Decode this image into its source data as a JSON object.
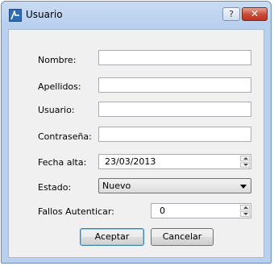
{
  "window": {
    "title": "Usuario",
    "help_label": "?",
    "close_label": "✕"
  },
  "form": {
    "nombre": {
      "label": "Nombre:",
      "value": ""
    },
    "apellidos": {
      "label": "Apellidos:",
      "value": ""
    },
    "usuario": {
      "label": "Usuario:",
      "value": ""
    },
    "contrasena": {
      "label": "Contraseña:",
      "value": ""
    },
    "fecha_alta": {
      "label": "Fecha alta:",
      "value": "23/03/2013"
    },
    "estado": {
      "label": "Estado:",
      "selected": "Nuevo"
    },
    "fallos": {
      "label": "Fallos Autenticar:",
      "value": "0"
    }
  },
  "buttons": {
    "accept": "Aceptar",
    "cancel": "Cancelar"
  },
  "colors": {
    "title_gradient_top": "#c9dcf3",
    "client_bg": "#f0f0f0",
    "close_button": "#c9503c"
  }
}
